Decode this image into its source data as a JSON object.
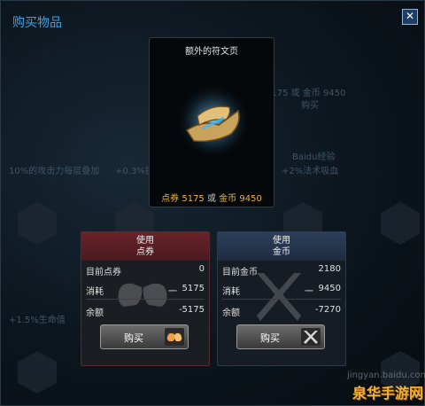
{
  "window": {
    "title": "购买物品",
    "close_glyph": "✕"
  },
  "item": {
    "name": "额外的符文页",
    "icon": "rune-page-scroll-icon",
    "price": {
      "rp": "点券 5175",
      "or": "或",
      "ip": "金币 9450"
    }
  },
  "pay_rp": {
    "header_line1": "使用",
    "header_line2": "点券",
    "rows": [
      {
        "label": "目前点券",
        "dash": "",
        "value": "0"
      },
      {
        "label": "消耗",
        "dash": "一",
        "value": "5175"
      },
      {
        "label": "余额",
        "dash": "",
        "value": "-5175"
      }
    ],
    "button_label": "购买",
    "button_icon": "fist-bump-icon"
  },
  "pay_ip": {
    "header_line1": "使用",
    "header_line2": "金币",
    "rows": [
      {
        "label": "目前金币",
        "dash": "",
        "value": "2180"
      },
      {
        "label": "消耗",
        "dash": "一",
        "value": "9450"
      },
      {
        "label": "余额",
        "dash": "",
        "value": "-7270"
      }
    ],
    "button_label": "购买",
    "button_icon": "crossed-swords-icon"
  },
  "background_text": {
    "a": "5175 或 金币 9450",
    "b": "购买",
    "c": "10%的攻击力每层叠加",
    "d": "+0.3%护甲",
    "e": "+2%法术吸血",
    "f": "Baidu经验",
    "g": "+1.5%生命值"
  },
  "watermark": {
    "text": "jingyan.baidu.com",
    "site": "泉华手游网"
  },
  "colors": {
    "title": "#3aa3e6",
    "price": "#e8b640",
    "rp_header": "#6a2329",
    "ip_header": "#2c3f5a"
  }
}
